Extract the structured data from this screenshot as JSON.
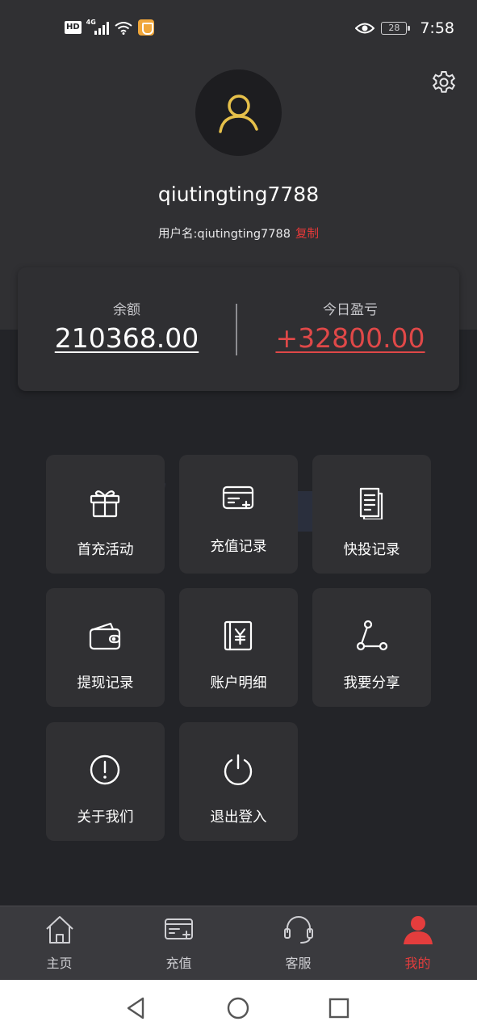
{
  "status_bar": {
    "hd_label": "HD",
    "network_label": "4G",
    "battery_level": "28",
    "time": "7:58"
  },
  "profile": {
    "nickname": "qiutingting7788",
    "username_prefix": "用户名:",
    "username": "qiutingting7788",
    "copy_label": "复制"
  },
  "balance": {
    "balance_label": "余额",
    "balance_value": "210368.00",
    "pnl_label": "今日盈亏",
    "pnl_value": "+32800.00"
  },
  "menu": {
    "first_recharge_activity": "首充活动",
    "recharge_records": "充值记录",
    "quick_bet_records": "快投记录",
    "withdraw_records": "提现记录",
    "account_details": "账户明细",
    "share": "我要分享",
    "about_us": "关于我们",
    "logout": "退出登入"
  },
  "tabbar": {
    "home": "主页",
    "recharge": "充值",
    "customer_service": "客服",
    "mine": "我的"
  },
  "colors": {
    "accent_red": "#e43d3d",
    "avatar_gold": "#e6c04a",
    "background_dark": "#232428",
    "header_dark": "#303033"
  }
}
